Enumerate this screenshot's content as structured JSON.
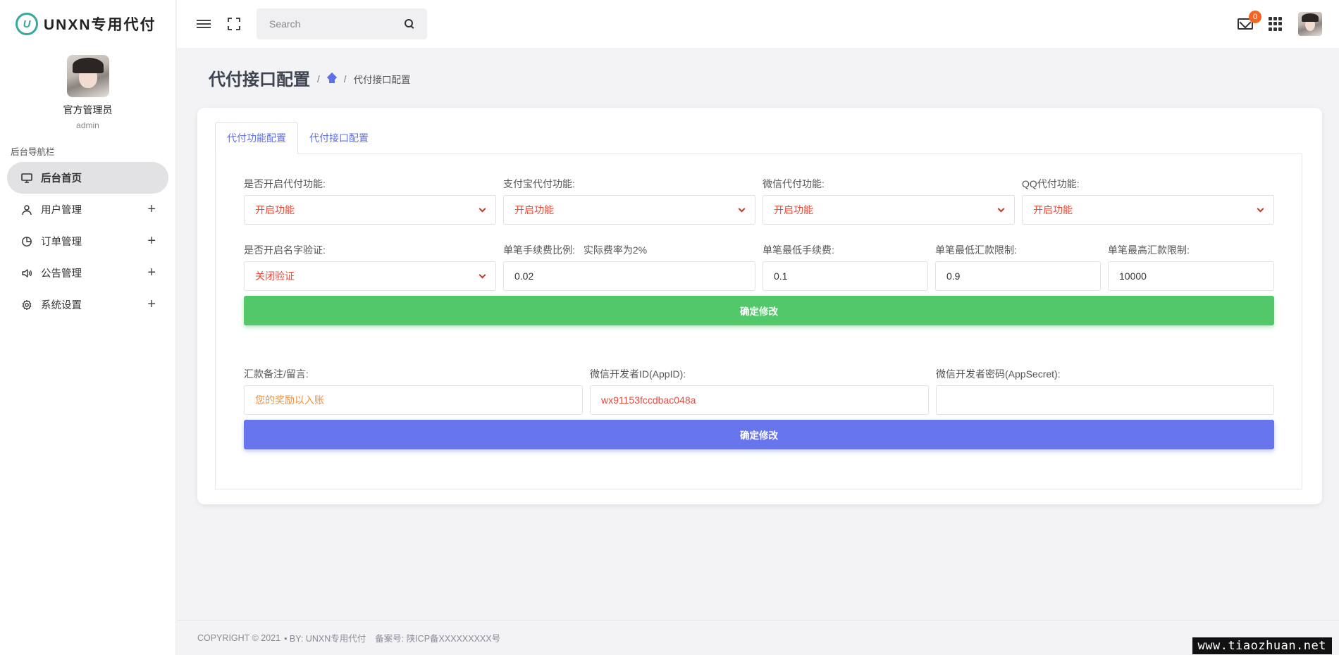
{
  "brand": {
    "logo_letter": "U",
    "name": "UNXN专用代付"
  },
  "profile": {
    "name": "官方管理员",
    "role": "admin"
  },
  "sidebar": {
    "title": "后台导航栏",
    "items": [
      {
        "label": "后台首页",
        "icon": "monitor-icon",
        "active": true
      },
      {
        "label": "用户管理",
        "icon": "user-icon",
        "expand": "+"
      },
      {
        "label": "订单管理",
        "icon": "pie-chart-icon",
        "expand": "+"
      },
      {
        "label": "公告管理",
        "icon": "speaker-icon",
        "expand": "+"
      },
      {
        "label": "系统设置",
        "icon": "gear-icon",
        "expand": "+"
      }
    ]
  },
  "topbar": {
    "search_placeholder": "Search",
    "mail_badge": "0"
  },
  "page": {
    "title": "代付接口配置",
    "breadcrumb": {
      "sep1": "/",
      "sep2": "/",
      "current": "代付接口配置"
    }
  },
  "tabs": [
    {
      "label": "代付功能配置",
      "active": true
    },
    {
      "label": "代付接口配置",
      "active": false
    }
  ],
  "form": {
    "row1": [
      {
        "label": "是否开启代付功能:",
        "value": "开启功能"
      },
      {
        "label": "支付宝代付功能:",
        "value": "开启功能"
      },
      {
        "label": "微信代付功能:",
        "value": "开启功能"
      },
      {
        "label": "QQ代付功能:",
        "value": "开启功能"
      }
    ],
    "row2": {
      "name_verify": {
        "label": "是否开启名字验证:",
        "value": "关闭验证"
      },
      "fee_rate": {
        "label": "单笔手续费比例:",
        "note": "实际费率为2%",
        "value": "0.02"
      },
      "min_fee": {
        "label": "单笔最低手续费:",
        "value": "0.1"
      },
      "min_amount": {
        "label": "单笔最低汇款限制:",
        "value": "0.9"
      },
      "max_amount": {
        "label": "单笔最高汇款限制:",
        "value": "10000"
      }
    },
    "submit1": "确定修改",
    "row3": {
      "remark": {
        "label": "汇款备注/留言:",
        "value": "您的奖励以入账"
      },
      "appid": {
        "label": "微信开发者ID(AppID):",
        "value": "wx91153fccdbac048a"
      },
      "appsecret": {
        "label": "微信开发者密码(AppSecret):",
        "value": ""
      }
    },
    "submit2": "确定修改"
  },
  "footer": {
    "copyright": "COPYRIGHT © 2021",
    "by": "• BY: UNXN专用代付",
    "icp": "备案号: 陕ICP备XXXXXXXXX号"
  },
  "watermark": "www.tiaozhuan.net",
  "colors": {
    "accent": "#5f6fe5",
    "select_text": "#e84b3c",
    "green_button": "#53c86b",
    "blue_button": "#6876ee",
    "badge": "#f26522"
  }
}
